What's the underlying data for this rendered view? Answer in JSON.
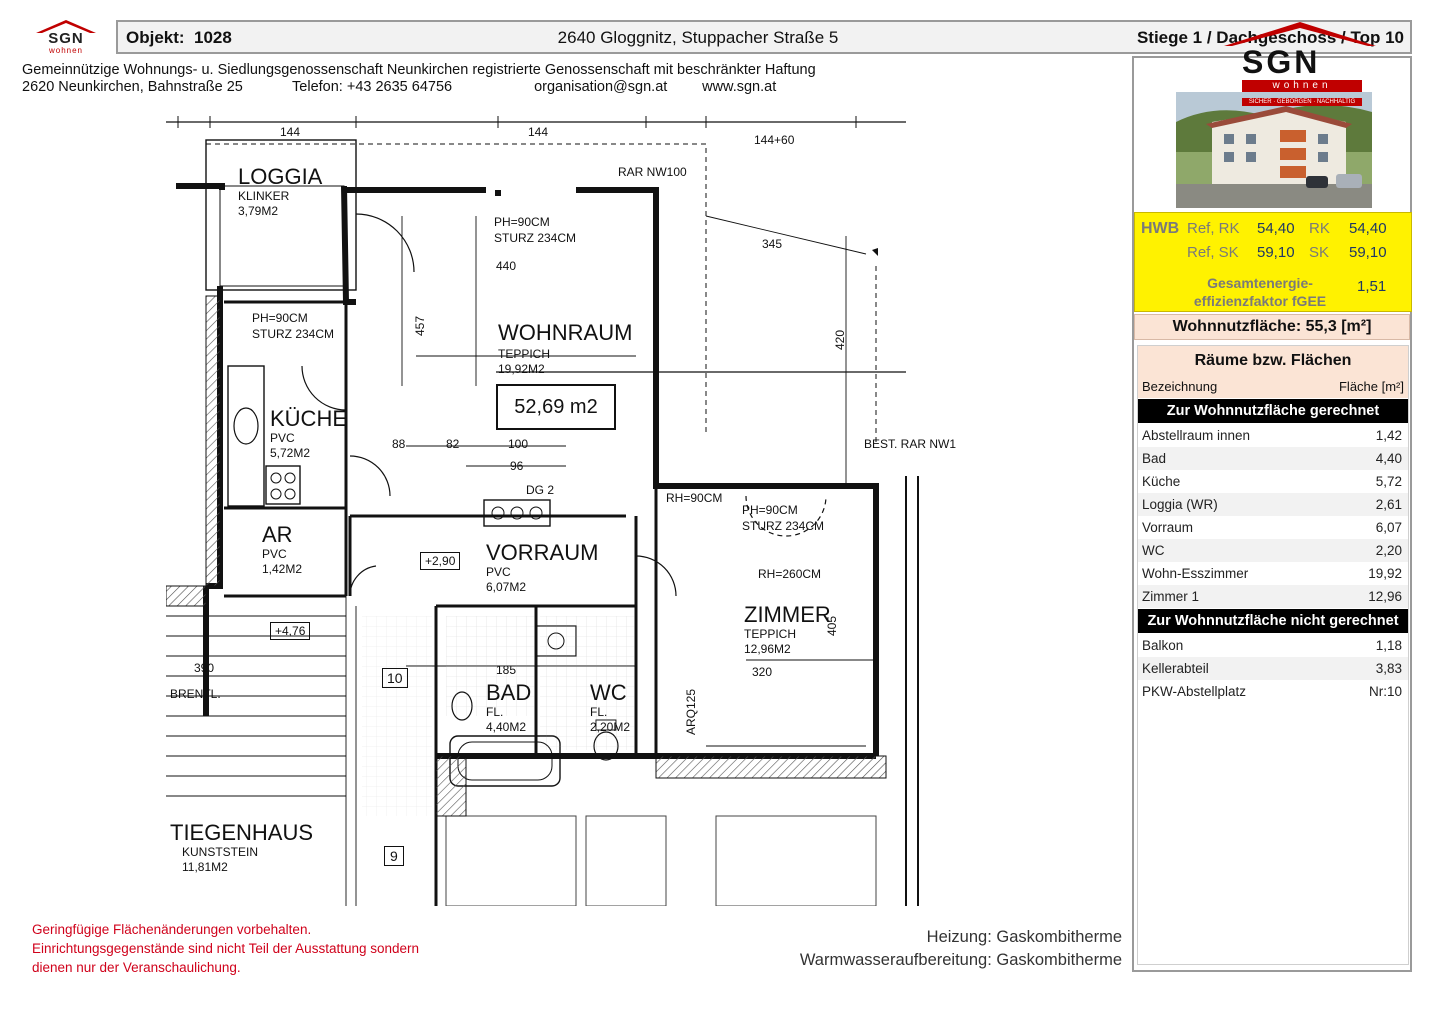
{
  "header": {
    "logo_text": "SGN",
    "logo_subtext": "wohnen",
    "objekt_label": "Objekt:",
    "objekt_number": "1028",
    "address": "2640 Gloggnitz, Stuppacher Straße 5",
    "location": "Stiege 1 / Dachgeschoss / Top 10"
  },
  "company": {
    "name": "Gemeinnützige Wohnungs- u. Siedlungsgenossenschaft Neunkirchen registrierte Genossenschaft mit beschränkter Haftung",
    "address": "2620 Neunkirchen, Bahnstraße 25",
    "phone": "Telefon: +43 2635 64756",
    "email": "organisation@sgn.at",
    "web": "www.sgn.at"
  },
  "brand": {
    "logo_text": "SGN",
    "logo_subtext": "wohnen",
    "tagline": "SICHER · GEBORGEN · NACHHALTIG",
    "accent_red": "#c00000",
    "hwb_yellow": "#fff200",
    "table_header_bg": "#fbe4d5"
  },
  "floorplan": {
    "total_area": "52,69 m2",
    "rooms": [
      {
        "name": "LOGGIA",
        "floor": "KLINKER",
        "area": "3,79M2"
      },
      {
        "name": "WOHNRAUM",
        "floor": "TEPPICH",
        "area": "19,92M2"
      },
      {
        "name": "KÜCHE",
        "floor": "PVC",
        "area": "5,72M2"
      },
      {
        "name": "AR",
        "floor": "PVC",
        "area": "1,42M2"
      },
      {
        "name": "VORRAUM",
        "floor": "PVC",
        "area": "6,07M2"
      },
      {
        "name": "ZIMMER",
        "floor": "TEPPICH",
        "area": "12,96M2"
      },
      {
        "name": "BAD",
        "floor": "FL.",
        "area": "4,40M2"
      },
      {
        "name": "WC",
        "floor": "FL.",
        "area": "2,20M2"
      },
      {
        "name": "TIEGENHAUS",
        "floor": "KUNSTSTEIN",
        "area": "11,81M2"
      }
    ],
    "notes": {
      "rar": "RAR NW100",
      "window_living": "PH=90CM",
      "sturz_living": "STURZ 234CM",
      "window_kitchen": "PH=90CM",
      "sturz_kitchen": "STURZ 234CM",
      "window_zimmer": "PH=90CM",
      "sturz_zimmer": "STURZ 234CM",
      "rh_zimmer": "RH=260CM",
      "rh_door": "RH=90CM",
      "level_vorraum": "+2,90",
      "level_stair": "+4,76",
      "stair_number_top": "10",
      "stair_number_bottom": "9",
      "brentl": "BRENTL.",
      "arq": "ARQ125",
      "dim_144": "144",
      "dim_144b": "144",
      "dim_144_60": "144+60",
      "dim_345": "345",
      "dim_440": "440",
      "dim_457": "457",
      "dim_420": "420",
      "dim_405": "405",
      "dim_320": "320",
      "dim_390": "390",
      "dim_185": "185",
      "dim_88": "88",
      "dim_82": "82",
      "dim_100": "100",
      "dim_96": "96",
      "dim_dg2": "DG 2",
      "best_rar": "BEST. RAR NW1"
    }
  },
  "energy": {
    "hwb_label": "HWB",
    "ref_rk_label": "Ref, RK",
    "ref_rk_value": "54,40",
    "rk_label": "RK",
    "rk_value": "54,40",
    "ref_sk_label": "Ref, SK",
    "ref_sk_value": "59,10",
    "sk_label": "SK",
    "sk_value": "59,10",
    "gee_label_1": "Gesamtenergie-",
    "gee_label_2": "effizienzfaktor fGEE",
    "gee_value": "1,51"
  },
  "living_area": "Wohnnutzfläche: 55,3 [m²]",
  "rooms_table": {
    "title": "Räume bzw. Flächen",
    "col_name": "Bezeichnung",
    "col_area": "Fläche [m²]",
    "section_included": "Zur Wohnnutzfläche gerechnet",
    "included": [
      {
        "name": "Abstellraum innen",
        "value": "1,42"
      },
      {
        "name": "Bad",
        "value": "4,40"
      },
      {
        "name": "Küche",
        "value": "5,72"
      },
      {
        "name": "Loggia (WR)",
        "value": "2,61"
      },
      {
        "name": "Vorraum",
        "value": "6,07"
      },
      {
        "name": "WC",
        "value": "2,20"
      },
      {
        "name": "Wohn-Esszimmer",
        "value": "19,92"
      },
      {
        "name": "Zimmer 1",
        "value": "12,96"
      }
    ],
    "section_excluded": "Zur Wohnnutzfläche nicht gerechnet",
    "excluded": [
      {
        "name": "Balkon",
        "value": "1,18"
      },
      {
        "name": "Kellerabteil",
        "value": "3,83"
      },
      {
        "name": "PKW-Abstellplatz",
        "value": "Nr:10"
      }
    ]
  },
  "footer": {
    "disclaimer_1": "Geringfügige Flächenänderungen vorbehalten.",
    "disclaimer_2": "Einrichtungsgegenstände sind nicht Teil der Ausstattung sondern",
    "disclaimer_3": "dienen nur der Veranschaulichung.",
    "heating": "Heizung: Gaskombitherme",
    "hot_water": "Warmwasseraufbereitung: Gaskombitherme"
  }
}
